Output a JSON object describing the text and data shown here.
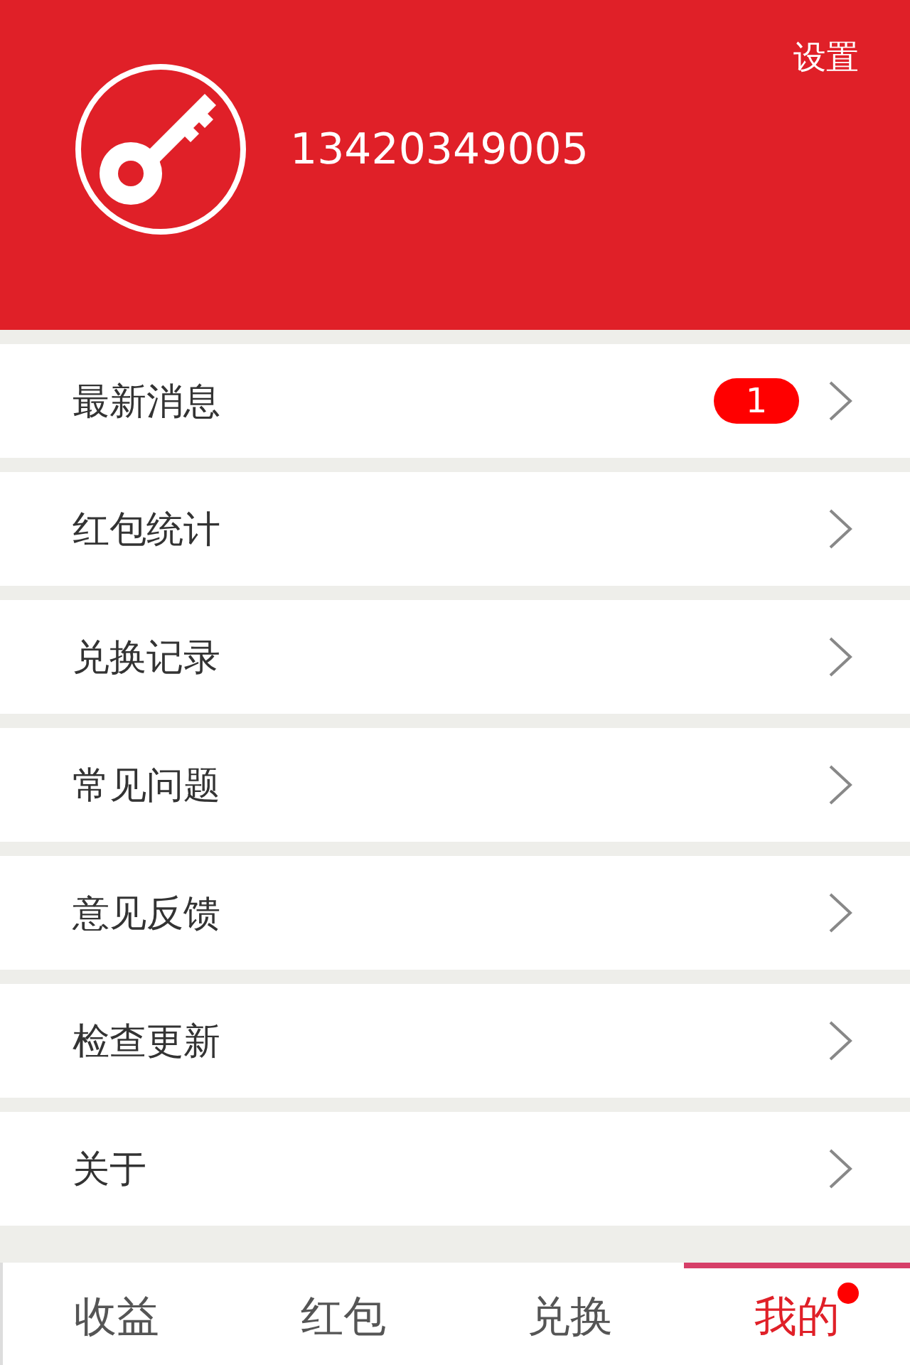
{
  "header": {
    "settings": "设置",
    "phone": "13420349005"
  },
  "menu": [
    {
      "label": "最新消息",
      "badge": "1"
    },
    {
      "label": "红包统计"
    },
    {
      "label": "兑换记录"
    },
    {
      "label": "常见问题"
    },
    {
      "label": "意见反馈"
    },
    {
      "label": "检查更新"
    },
    {
      "label": "关于"
    }
  ],
  "tabs": [
    {
      "label": "收益",
      "selected": false,
      "dot": false
    },
    {
      "label": "红包",
      "selected": false,
      "dot": false
    },
    {
      "label": "兑换",
      "selected": false,
      "dot": false
    },
    {
      "label": "我的",
      "selected": true,
      "dot": true
    }
  ]
}
